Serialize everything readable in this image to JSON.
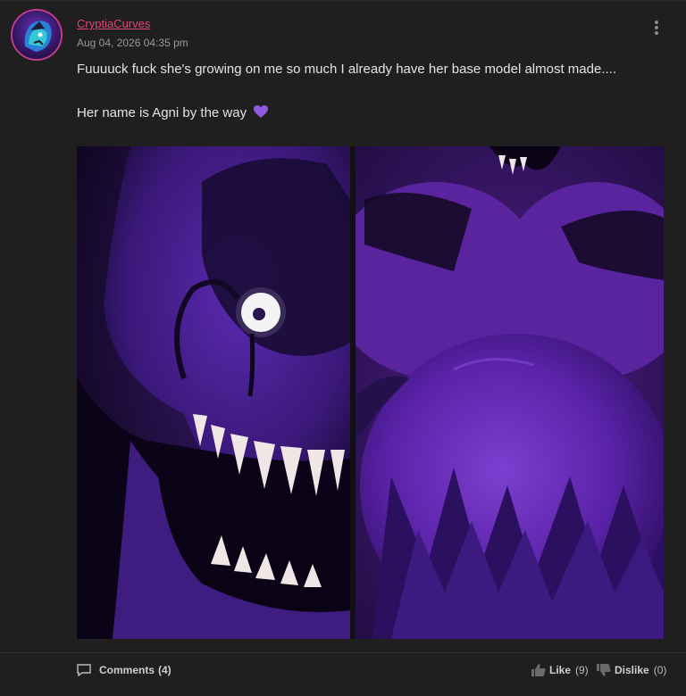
{
  "post": {
    "author": "CryptiaCurves",
    "timestamp": "Aug 04, 2026 04:35 pm",
    "text_line1": "Fuuuuck fuck she's growing on me so much I already have her base model almost made....",
    "text_line2": "Her name is Agni by the way",
    "heart_emoji": "💜",
    "image_alt": "Two-panel render of a purple creature character: close-up of face with glowing eye and sharp teeth (left), torso view (right)"
  },
  "footer": {
    "comments_label": "Comments",
    "comments_count": "(4)",
    "like_label": "Like",
    "like_count": "(9)",
    "dislike_label": "Dislike",
    "dislike_count": "(0)"
  },
  "colors": {
    "background": "#1f1f1f",
    "username": "#e0457b",
    "avatar_ring": "#c23c8e",
    "heart": "#8e5be0"
  },
  "icons": {
    "more": "more-vertical-icon",
    "comments": "comment-icon",
    "like": "thumbs-up-icon",
    "dislike": "thumbs-down-icon"
  }
}
